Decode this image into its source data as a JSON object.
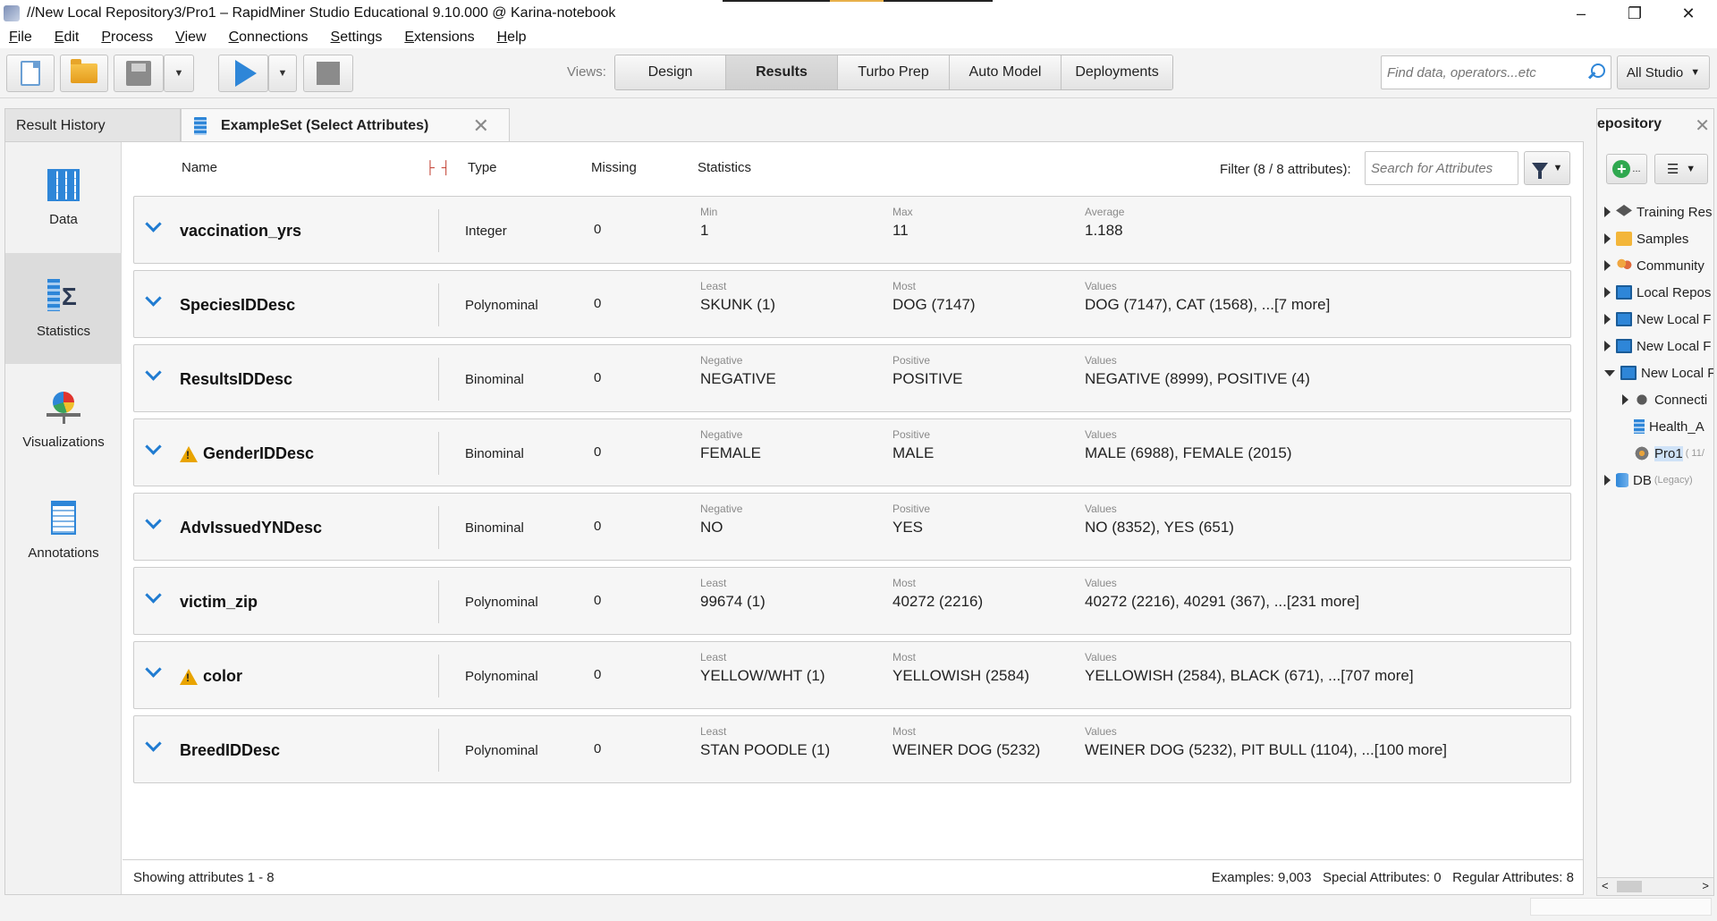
{
  "window": {
    "title": "//New Local Repository3/Pro1 – RapidMiner Studio Educational 9.10.000 @ Karina-notebook",
    "minimize": "–",
    "maximize": "❐",
    "close": "✕"
  },
  "menu": [
    "File",
    "Edit",
    "Process",
    "View",
    "Connections",
    "Settings",
    "Extensions",
    "Help"
  ],
  "toolbar": {
    "views_label": "Views:",
    "views": [
      "Design",
      "Results",
      "Turbo Prep",
      "Auto Model",
      "Deployments"
    ],
    "active_view": "Results",
    "search_placeholder": "Find data, operators...etc",
    "scope": "All Studio"
  },
  "tabs": {
    "history": "Result History",
    "example": "ExampleSet (Select Attributes)",
    "close": "✕"
  },
  "sidenav": [
    {
      "label": "Data",
      "icon": "data-table-icon"
    },
    {
      "label": "Statistics",
      "icon": "statistics-icon"
    },
    {
      "label": "Visualizations",
      "icon": "visualizations-icon"
    },
    {
      "label": "Annotations",
      "icon": "annotations-icon"
    }
  ],
  "active_sidenav": "Statistics",
  "stats_header": {
    "name": "Name",
    "type": "Type",
    "missing": "Missing",
    "statistics": "Statistics",
    "filter_label": "Filter (8 / 8 attributes):",
    "search_placeholder": "Search for Attributes"
  },
  "attributes": [
    {
      "name": "vaccination_yrs",
      "warning": false,
      "type": "Integer",
      "missing": "0",
      "s1_key": "Min",
      "s1_val": "1",
      "s2_key": "Max",
      "s2_val": "11",
      "s3_key": "Average",
      "s3_val": "1.188"
    },
    {
      "name": "SpeciesIDDesc",
      "warning": false,
      "type": "Polynominal",
      "missing": "0",
      "s1_key": "Least",
      "s1_val": "SKUNK (1)",
      "s2_key": "Most",
      "s2_val": "DOG (7147)",
      "s3_key": "Values",
      "s3_val": "DOG (7147), CAT (1568), ...[7 more]"
    },
    {
      "name": "ResultsIDDesc",
      "warning": false,
      "type": "Binominal",
      "missing": "0",
      "s1_key": "Negative",
      "s1_val": "NEGATIVE",
      "s2_key": "Positive",
      "s2_val": "POSITIVE",
      "s3_key": "Values",
      "s3_val": "NEGATIVE (8999), POSITIVE (4)"
    },
    {
      "name": "GenderIDDesc",
      "warning": true,
      "type": "Binominal",
      "missing": "0",
      "s1_key": "Negative",
      "s1_val": "FEMALE",
      "s2_key": "Positive",
      "s2_val": "MALE",
      "s3_key": "Values",
      "s3_val": "MALE (6988), FEMALE (2015)"
    },
    {
      "name": "AdvIssuedYNDesc",
      "warning": false,
      "type": "Binominal",
      "missing": "0",
      "s1_key": "Negative",
      "s1_val": "NO",
      "s2_key": "Positive",
      "s2_val": "YES",
      "s3_key": "Values",
      "s3_val": "NO (8352), YES (651)"
    },
    {
      "name": "victim_zip",
      "warning": false,
      "type": "Polynominal",
      "missing": "0",
      "s1_key": "Least",
      "s1_val": "99674 (1)",
      "s2_key": "Most",
      "s2_val": "40272 (2216)",
      "s3_key": "Values",
      "s3_val": "40272 (2216), 40291 (367), ...[231 more]"
    },
    {
      "name": "color",
      "warning": true,
      "type": "Polynominal",
      "missing": "0",
      "s1_key": "Least",
      "s1_val": "YELLOW/WHT (1)",
      "s2_key": "Most",
      "s2_val": "YELLOWISH (2584)",
      "s3_key": "Values",
      "s3_val": "YELLOWISH (2584), BLACK (671), ...[707 more]"
    },
    {
      "name": "BreedIDDesc",
      "warning": false,
      "type": "Polynominal",
      "missing": "0",
      "s1_key": "Least",
      "s1_val": "STAN POODLE (1)",
      "s2_key": "Most",
      "s2_val": "WEINER DOG (5232)",
      "s3_key": "Values",
      "s3_val": "WEINER DOG (5232), PIT BULL (1104), ...[100 more]"
    }
  ],
  "footer": {
    "left": "Showing attributes 1 - 8",
    "right": "Examples: 9,003   Special Attributes: 0   Regular Attributes: 8"
  },
  "repository": {
    "title": "epository",
    "close": "✕",
    "items": [
      {
        "label": "Training Res",
        "icon": "grad-cap-icon",
        "level": 0,
        "expand": "closed"
      },
      {
        "label": "Samples",
        "icon": "folder-icon",
        "level": 0,
        "expand": "closed"
      },
      {
        "label": "Community",
        "icon": "community-icon",
        "level": 0,
        "expand": "closed"
      },
      {
        "label": "Local Repos",
        "icon": "monitor-icon",
        "level": 0,
        "expand": "closed"
      },
      {
        "label": "New Local F",
        "icon": "monitor-icon",
        "level": 0,
        "expand": "closed"
      },
      {
        "label": "New Local F",
        "icon": "monitor-icon",
        "level": 0,
        "expand": "closed"
      },
      {
        "label": "New Local F",
        "icon": "monitor-icon",
        "level": 0,
        "expand": "open"
      },
      {
        "label": "Connecti",
        "icon": "connection-icon",
        "level": 1,
        "expand": "closed"
      },
      {
        "label": "Health_A",
        "icon": "data-icon",
        "level": 1,
        "expand": "none"
      },
      {
        "label": "Pro1",
        "suffix": "( 11/",
        "icon": "process-gear-icon",
        "level": 1,
        "expand": "none",
        "selected": true
      },
      {
        "label": "DB",
        "suffix": "(Legacy)",
        "icon": "database-icon",
        "level": 0,
        "expand": "closed"
      }
    ]
  }
}
